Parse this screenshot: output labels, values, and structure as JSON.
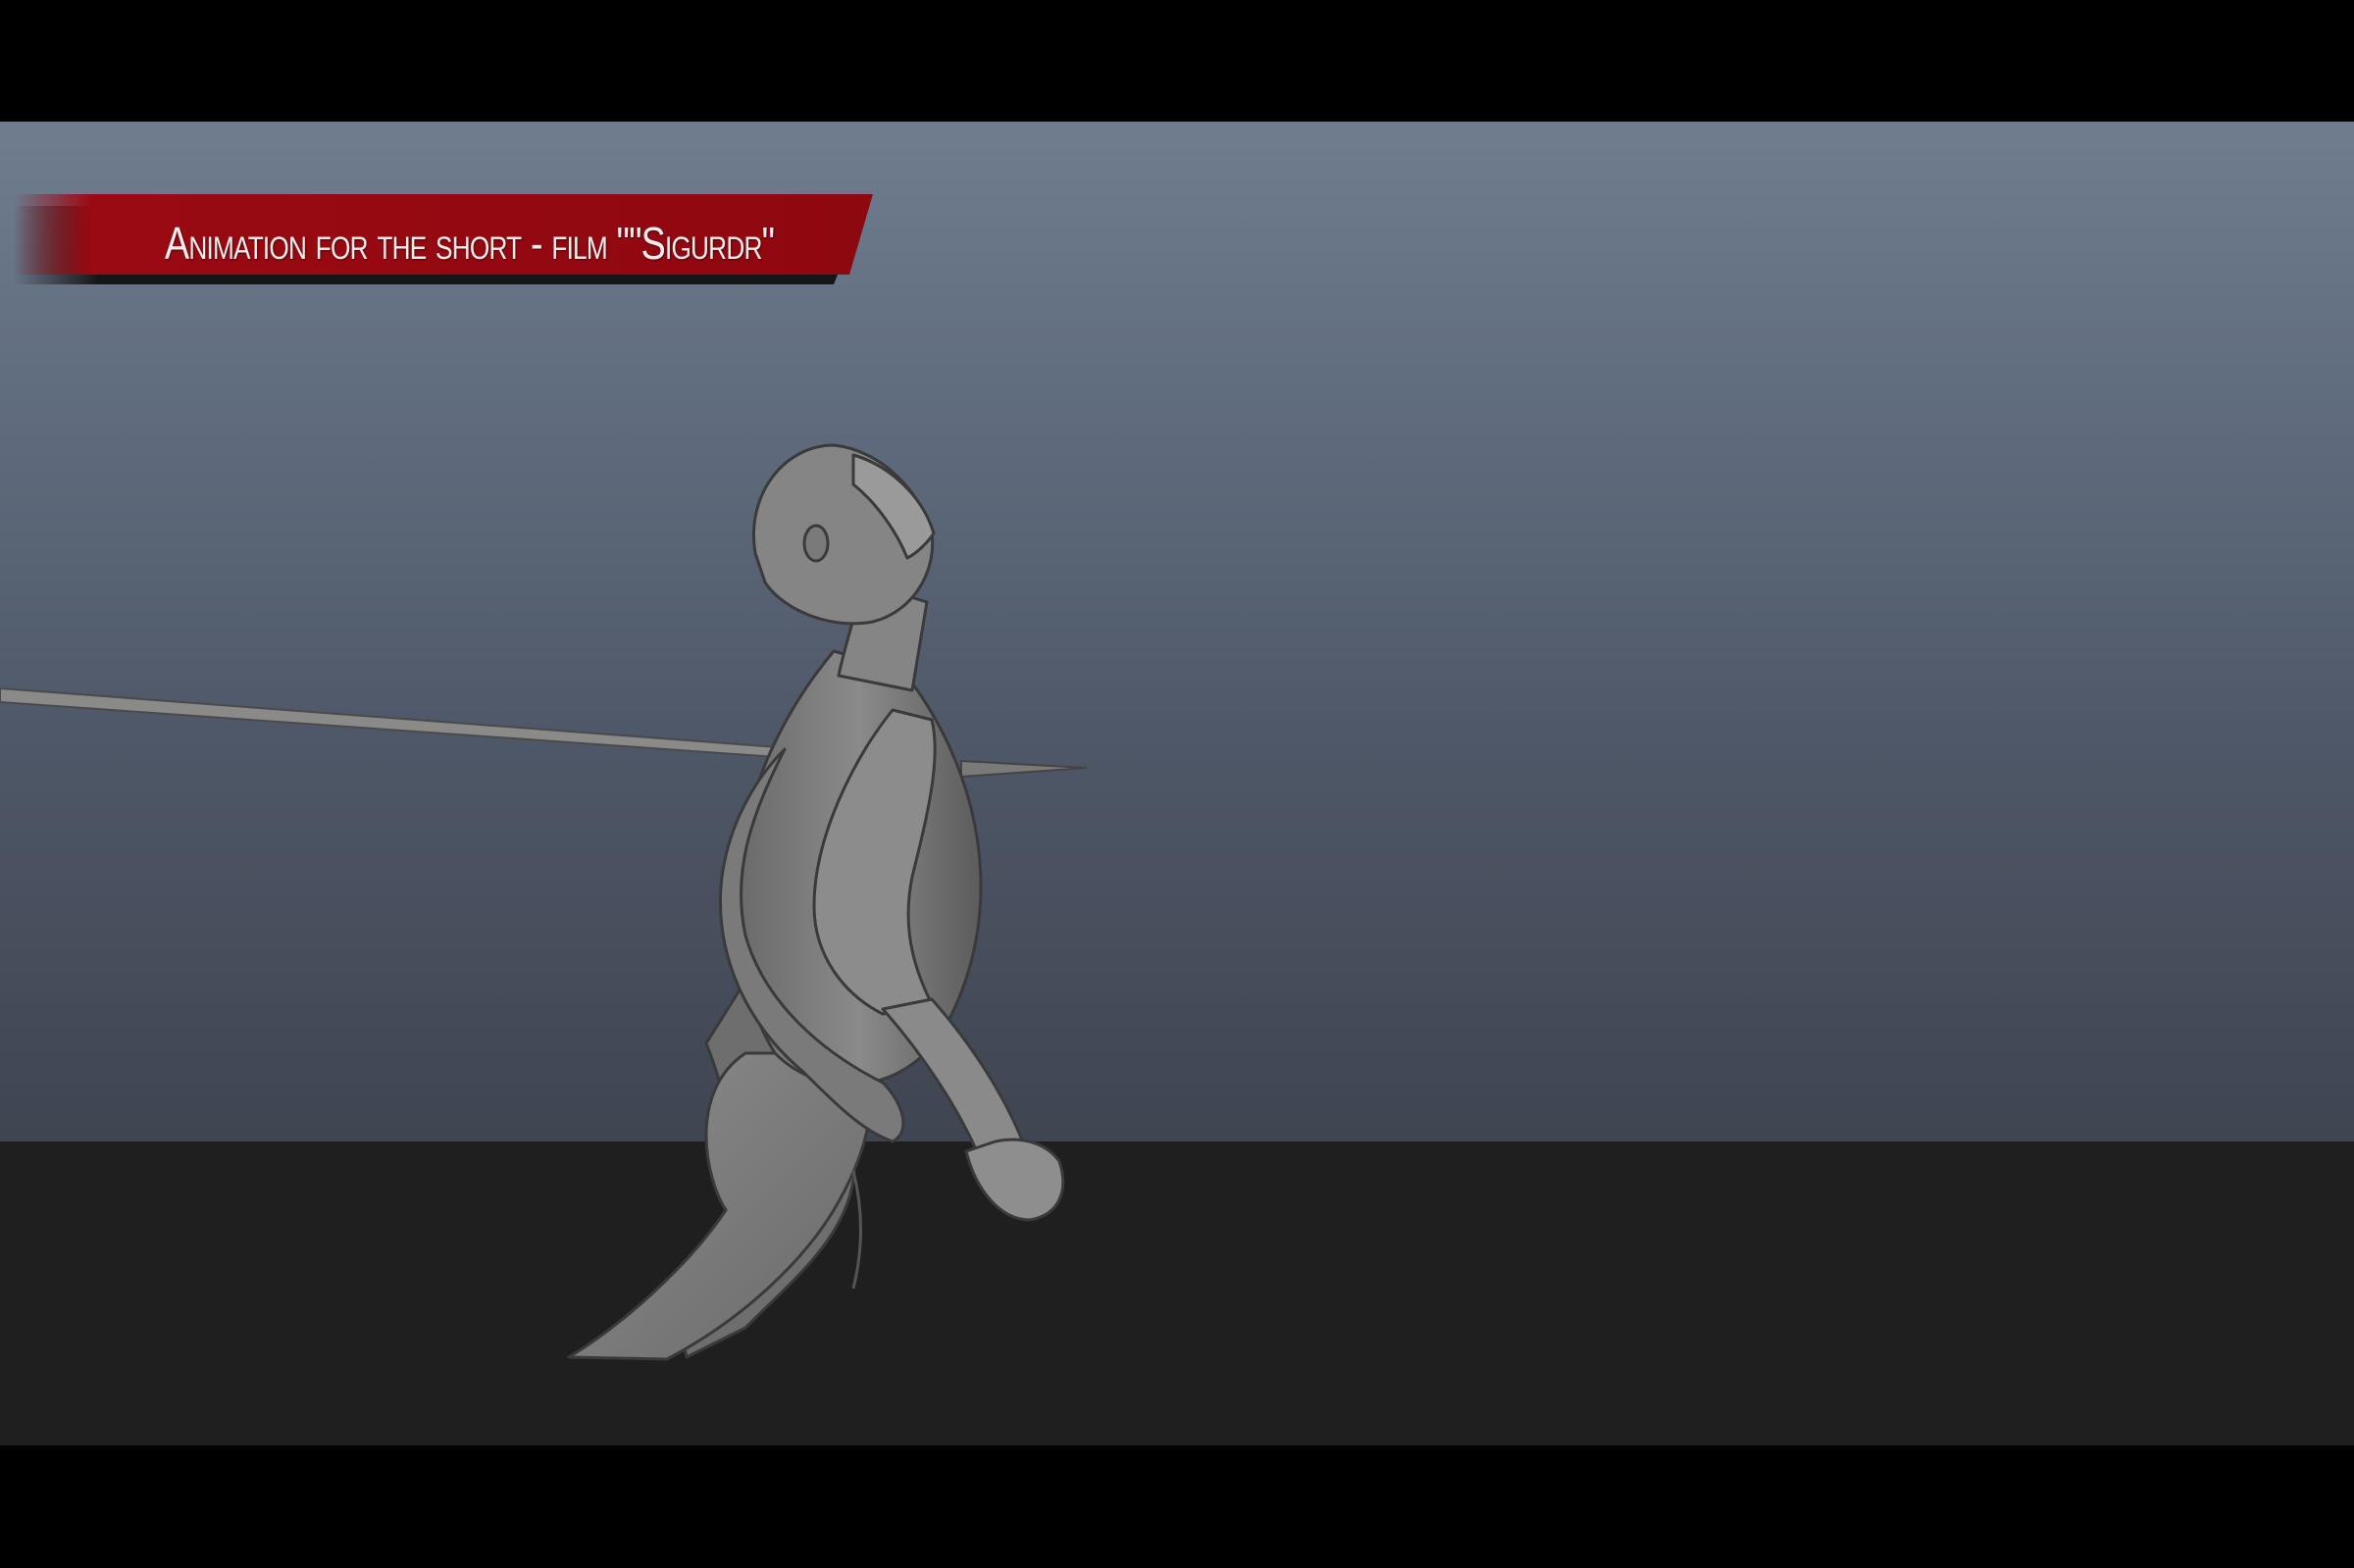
{
  "banner": {
    "title": "Animation for the short - film \"\"Sigurdr\"",
    "color": "#9a0a12"
  },
  "scene": {
    "figure": "crouching-humanoid-mesh",
    "prop": "spear",
    "sky_color": "#5f6b7d",
    "ground_color": "#1f1f1f"
  }
}
